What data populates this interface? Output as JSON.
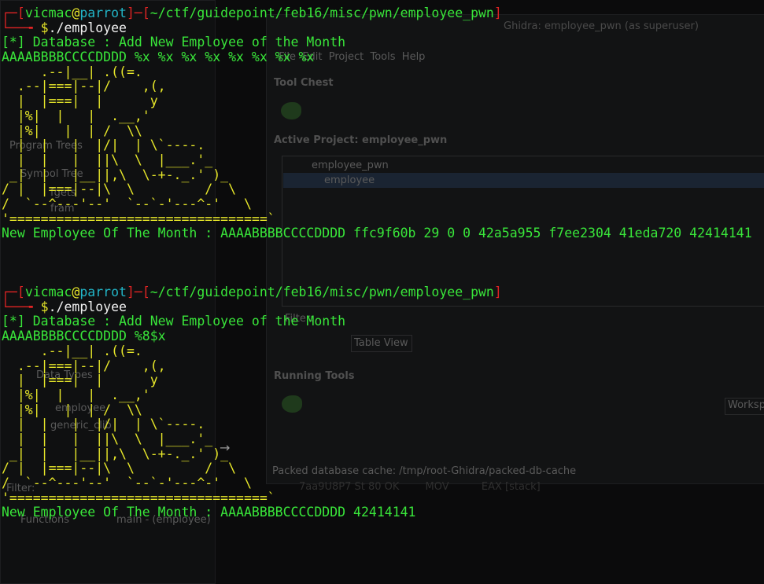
{
  "background_window": {
    "title": "Ghidra: employee_pwn (as superuser)",
    "menu": [
      "File",
      "Edit",
      "Project",
      "Tools",
      "Help"
    ],
    "tool_chest_label": "Tool Chest",
    "active_project_label": "Active Project: employee_pwn",
    "project_folder": "employee_pwn",
    "project_file": "employee",
    "filter_label": "Filter:",
    "table_view_button": "Table View",
    "running_tools_label": "Running Tools",
    "workspace_label": "Worksp",
    "status_text": "Packed database cache: /tmp/root-Ghidra/packed-db-cache",
    "left_panel_snippets": [
      "Program Trees",
      "Symbol Tree",
      "fgets",
      "fram",
      "Data Types",
      "employee",
      "generic_clib",
      "Filter:",
      "Functions",
      "main - (employee)"
    ]
  },
  "terminal": {
    "sessions": [
      {
        "prompt": {
          "user": "vicmac",
          "at": "@",
          "host": "parrot",
          "path": "~/ctf/guidepoint/feb16/misc/pwn/employee_pwn",
          "symbol": "$",
          "command": "./employee"
        },
        "info_line": "[*] Database : Add New Employee of the Month",
        "input_line": "AAAABBBBCCCCDDDD %x %x %x %x %x %x %x %x",
        "art_lines": [
          "     .--|__| .((=.",
          "  .--|===|--|/    ,(,",
          "  |  |===|  |      y",
          "  |%|  |   |  .__,'",
          "  |%|   |  | /  \\\\",
          "  |  |   |  |/|  | \\`----.",
          "  |  |   |  ||\\  \\  |___.'_",
          " _|  |   |__||,\\  \\-+-._.' )_",
          "/ |  |===|--|\\  \\         /  \\",
          "/  `--^---'--'  `--`-'---^-'   \\",
          "'=================================`"
        ],
        "result_line": "New Employee Of The Month : AAAABBBBCCCCDDDD ffc9f60b 29 0 0 42a5a955 f7ee2304 41eda720 42414141"
      },
      {
        "prompt": {
          "user": "vicmac",
          "at": "@",
          "host": "parrot",
          "path": "~/ctf/guidepoint/feb16/misc/pwn/employee_pwn",
          "symbol": "$",
          "command": "./employee"
        },
        "info_line": "[*] Database : Add New Employee of the Month",
        "input_line": "AAAABBBBCCCCDDDD %8$x",
        "art_lines": [
          "     .--|__| .((=.",
          "  .--|===|--|/    ,(,",
          "  |  |===|  |      y",
          "  |%|  |   |  .__,'",
          "  |%|   |  | /  \\\\",
          "  |  |   |  |/|  | \\`----.",
          "  |  |   |  ||\\  \\  |___.'_",
          " _|  |   |__||,\\  \\-+-._.' )_",
          "/ |  |===|--|\\  \\         /  \\",
          "/  `--^---'--'  `--`-'---^-'   \\",
          "'=================================`"
        ],
        "result_line": "New Employee Of The Month : AAAABBBBCCCCDDDD 42414141"
      }
    ]
  },
  "colors": {
    "bracket": "#e02424",
    "user": "#39e63a",
    "host": "#22b6c8",
    "path": "#e02424",
    "output": "#39e63a",
    "art": "#e8e82a"
  }
}
